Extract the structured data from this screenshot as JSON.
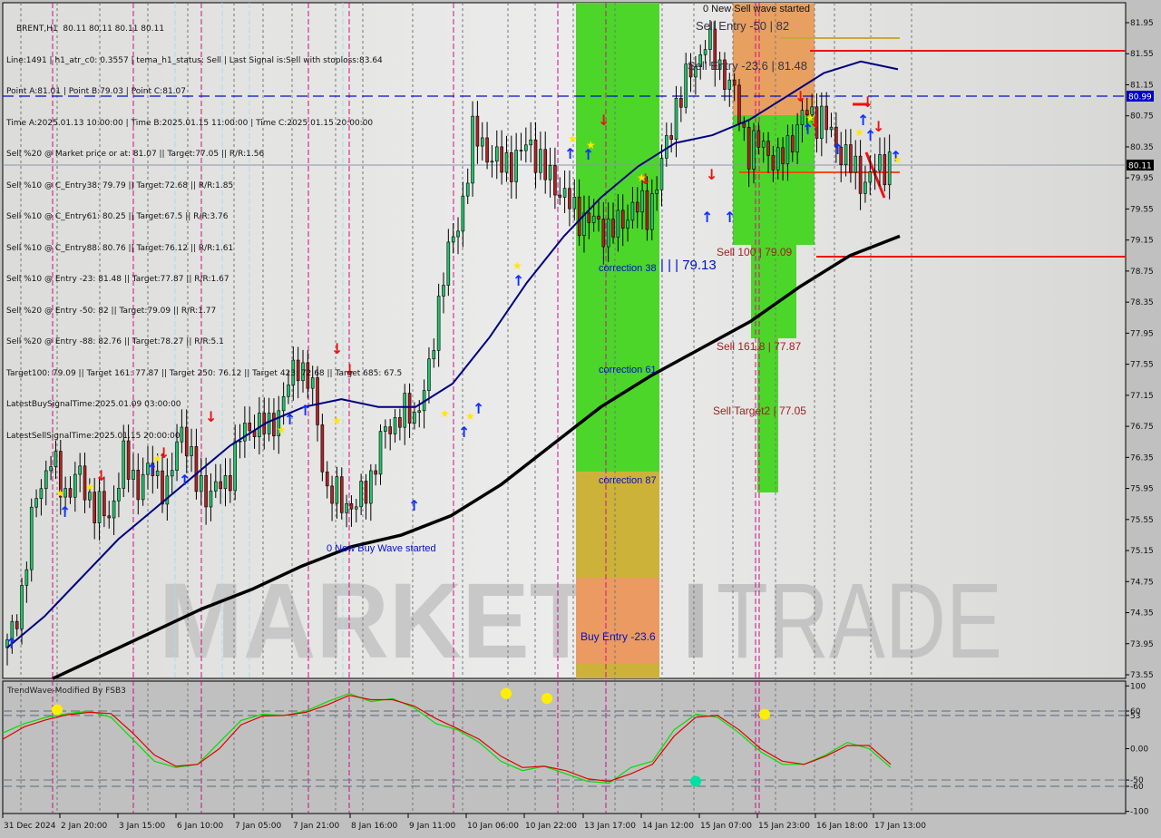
{
  "header": {
    "symbol_line": "BRENT,H1  80.11 80.11 80.11 80.11",
    "info_lines": [
      "Line:1491 | h1_atr_c0: 0.3557 | tema_h1_status: Sell | Last Signal is:Sell with stoploss:83.64",
      "Point A:81.01 | Point B:79.03 | Point C:81.07",
      "Time A:2025.01.13 10:00:00 | Time B:2025.01.15 11:00:00 | Time C:2025.01.15 20:00:00",
      "Sell %20 @ Market price or at: 81.07 || Target:77.05 || R/R:1.56",
      "Sell %10 @ C_Entry38: 79.79 || Target:72.68 || R/R:1.85",
      "Sell %10 @ C_Entry61: 80.25 || Target:67.5 || R/R:3.76",
      "Sell %10 @ C_Entry88: 80.76 || Target:76.12 || R/R:1.61",
      "Sell %10 @ Entry -23: 81.48 || Target:77.87 || R/R:1.67",
      "Sell %20 @ Entry -50: 82 || Target:79.09 || R/R:1.77",
      "Sell %20 @ Entry -88: 82.76 || Target:78.27 || R/R:5.1",
      "Target100: 79.09 || Target 161: 77.87 || Target 250: 76.12 || Target 423: 72.68 || Target 685: 67.5",
      "LatestBuySignalTime:2025.01.09 03:00:00",
      "LatestSellSignalTime:2025.01.15 20:00:00"
    ]
  },
  "watermark": {
    "left": "MARKETZ",
    "mid": "I",
    "right": "TRADE"
  },
  "colors": {
    "background": "#c0c0c0",
    "plot_bg": "#e4e4e2",
    "bull_candle": "#22c46a",
    "bear_candle": "#b22222",
    "ma_fast": "#000080",
    "ma_slow": "#000000",
    "envelope": "#ff5a1a",
    "zone_green": "#4cd62a",
    "zone_orange": "#e8a060",
    "zone_gold": "#cdb23a",
    "level_red": "#ee1111",
    "level_blue": "#0010c8",
    "price_label_bg": "#0000cc",
    "current_label_bg": "#000000",
    "osc_green": "#00e000",
    "osc_red": "#e00000"
  },
  "chart_data": [
    {
      "type": "candlestick",
      "title": "BRENT,H1",
      "ylim": [
        73.45,
        82.15
      ],
      "y_ticks": [
        "81.95",
        "81.55",
        "81.15",
        "80.75",
        "80.35",
        "79.95",
        "79.55",
        "79.15",
        "78.75",
        "78.35",
        "77.95",
        "77.55",
        "77.15",
        "76.75",
        "76.35",
        "75.95",
        "75.55",
        "75.15",
        "74.75",
        "74.35",
        "73.95",
        "73.55"
      ],
      "x_ticks": [
        "31 Dec 2024",
        "2 Jan 20:00",
        "3 Jan 15:00",
        "6 Jan 10:00",
        "7 Jan 05:00",
        "7 Jan 21:00",
        "8 Jan 16:00",
        "9 Jan 11:00",
        "10 Jan 06:00",
        "10 Jan 22:00",
        "13 Jan 17:00",
        "14 Jan 12:00",
        "15 Jan 07:00",
        "15 Jan 23:00",
        "16 Jan 18:00",
        "17 Jan 13:00"
      ],
      "price_labels": [
        {
          "value": "80.99",
          "kind": "level"
        },
        {
          "value": "80.11",
          "kind": "current"
        }
      ],
      "close_path": [
        73.9,
        74.6,
        75.9,
        76.3,
        75.9,
        76.1,
        75.7,
        75.6,
        76.3,
        76.0,
        76.2,
        75.9,
        76.8,
        76.0,
        75.9,
        76.0,
        76.6,
        76.8,
        76.7,
        77.1,
        77.6,
        77.2,
        75.9,
        75.8,
        75.7,
        76.1,
        76.7,
        76.9,
        76.9,
        77.4,
        78.8,
        79.3,
        80.5,
        80.3,
        80.1,
        80.2,
        80.4,
        80.0,
        79.8,
        79.5,
        79.4,
        79.3,
        79.3,
        79.6,
        79.5,
        80.1,
        80.9,
        81.3,
        81.7,
        81.4,
        81.0,
        80.3,
        80.4,
        80.1,
        80.5,
        80.8,
        80.7,
        80.4,
        80.1,
        79.9,
        80.1,
        80.2
      ],
      "ma_fast": [
        73.9,
        74.3,
        74.8,
        75.3,
        75.7,
        76.1,
        76.5,
        76.8,
        77.0,
        77.1,
        77.0,
        77.0,
        77.3,
        77.9,
        78.6,
        79.2,
        79.7,
        80.1,
        80.4,
        80.5,
        80.7,
        81.0,
        81.3,
        81.45,
        81.35
      ],
      "ma_slow": [
        73.5,
        73.8,
        74.1,
        74.4,
        74.65,
        74.95,
        75.2,
        75.35,
        75.6,
        76.0,
        76.5,
        77.0,
        77.4,
        77.75,
        78.1,
        78.55,
        78.95,
        79.2
      ],
      "levels": [
        {
          "label": "Sell Entry -50 | 82",
          "value": 82.0
        },
        {
          "label": "Sell Entry -23.6 | 81.48",
          "value": 81.48
        },
        {
          "label": "Sell 100 | 79.09",
          "value": 79.09
        },
        {
          "label": "Sell 161.8 | 77.87",
          "value": 77.87
        },
        {
          "label": "Sell Target2 | 77.05",
          "value": 77.05
        },
        {
          "label": "correction 38",
          "value": 79.13
        },
        {
          "label": "correction 61",
          "value": 77.6
        },
        {
          "label": "correction 87",
          "value": 76.2
        },
        {
          "label": "Buy Entry -23.6",
          "value": 74.0
        },
        {
          "label": "| | | 79.13",
          "value": 79.13
        }
      ],
      "horizontal_lines": [
        {
          "name": "red-upper-level",
          "value": 81.55
        },
        {
          "name": "gold-level",
          "value": 81.75
        },
        {
          "name": "blue-dashed-level",
          "value": 80.99
        },
        {
          "name": "red-lower-level",
          "value": 78.93
        },
        {
          "name": "orange-mid-level",
          "value": 80.05
        }
      ],
      "annotations": [
        "0 New Sell wave started",
        "0 New Buy Wave started"
      ]
    },
    {
      "type": "line",
      "title": "TrendWave-Modified By FSB3",
      "ylim": [
        -100,
        100
      ],
      "y_ticks": [
        "100",
        "60",
        "53",
        "0.00",
        "-50",
        "-60",
        "-100"
      ],
      "reference_levels": [
        60,
        53,
        -50,
        -60
      ],
      "series": [
        {
          "name": "fast",
          "color": "green",
          "values": [
            25,
            40,
            50,
            56,
            60,
            50,
            15,
            -20,
            -30,
            -25,
            10,
            45,
            55,
            53,
            60,
            75,
            88,
            75,
            80,
            65,
            40,
            30,
            10,
            -20,
            -35,
            -28,
            -40,
            -52,
            -55,
            -30,
            -20,
            30,
            55,
            50,
            25,
            -5,
            -25,
            -25,
            -10,
            10,
            0,
            -30
          ]
        },
        {
          "name": "slow",
          "color": "red",
          "values": [
            15,
            35,
            46,
            54,
            58,
            56,
            25,
            -10,
            -28,
            -25,
            0,
            38,
            52,
            53,
            58,
            70,
            85,
            78,
            78,
            68,
            48,
            32,
            15,
            -12,
            -30,
            -28,
            -35,
            -48,
            -52,
            -40,
            -25,
            20,
            50,
            53,
            30,
            0,
            -20,
            -25,
            -12,
            5,
            5,
            -25
          ]
        }
      ],
      "markers": [
        {
          "kind": "yellow-dot",
          "value": 62
        },
        {
          "kind": "yellow-dot",
          "value": 88
        },
        {
          "kind": "yellow-dot",
          "value": 80
        },
        {
          "kind": "yellow-dot",
          "value": 55
        },
        {
          "kind": "cyan-dot",
          "value": -52
        }
      ]
    }
  ]
}
